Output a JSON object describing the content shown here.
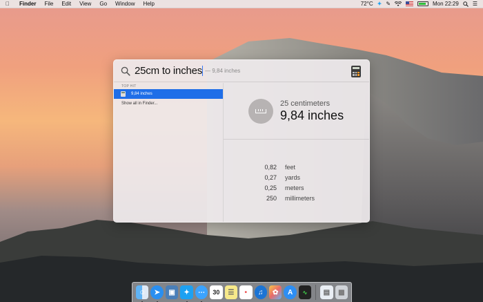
{
  "menubar": {
    "app_name": "Finder",
    "menus": [
      "File",
      "Edit",
      "View",
      "Go",
      "Window",
      "Help"
    ],
    "temperature": "72°C",
    "clock": "Mon 22:29",
    "icons": [
      "apple-icon",
      "twitter-icon",
      "script-icon",
      "wifi-icon",
      "flag-icon",
      "battery-icon",
      "search-icon",
      "list-icon"
    ],
    "battery_level": 0.8
  },
  "spotlight": {
    "query": "25cm to inches",
    "suggestion": "— 9,84 inches",
    "section_label": "TOP HIT",
    "top_hit": "9,84 inches",
    "show_all": "Show all in Finder...",
    "preview": {
      "from": "25 centimeters",
      "to": "9,84 inches",
      "others": [
        {
          "value": "0,82",
          "unit": "feet"
        },
        {
          "value": "0,27",
          "unit": "yards"
        },
        {
          "value": "0,25",
          "unit": "meters"
        },
        {
          "value": "250",
          "unit": "millimeters"
        }
      ]
    }
  },
  "dock": {
    "calendar_day": "30",
    "apps": [
      "finder-icon",
      "safari-icon",
      "preview-icon",
      "twitter-icon",
      "messages-icon",
      "calendar-icon",
      "notes-icon",
      "reminders-icon",
      "itunes-icon",
      "photos-icon",
      "app-store-icon",
      "activity-monitor-icon",
      "documents-icon",
      "trash-icon"
    ]
  }
}
